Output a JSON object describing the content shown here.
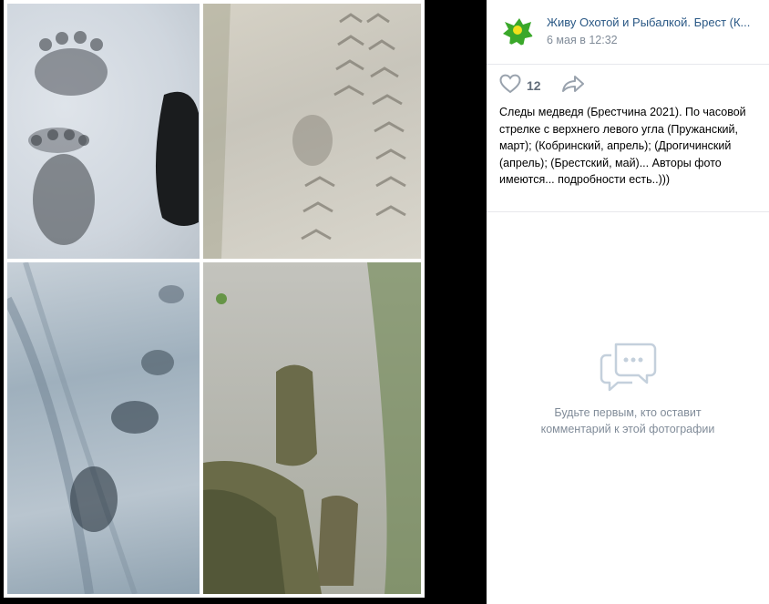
{
  "photo": {
    "alt": "",
    "tiles": [
      "track-snow",
      "track-dirt",
      "track-sand",
      "boots-on-ground"
    ]
  },
  "post": {
    "author": "Живу Охотой и Рыбалкой. Брест (К...",
    "date": "6 мая в 12:32",
    "likes": "12",
    "description": "Следы медведя (Брестчина 2021). По часовой стрелке с верхнего левого угла (Пружанский, март); (Кобринский, апрель); (Дрогичинский (апрель); (Брестский, май)... Авторы фото имеются... подробности есть..)))"
  },
  "comments": {
    "empty_text": "Будьте первым, кто оставит комментарий к этой фотографии"
  },
  "icons": {
    "like": "heart-icon",
    "share": "share-arrow-icon",
    "comments": "comments-bubble-icon"
  },
  "colors": {
    "link": "#2a5885",
    "muted": "#818c99",
    "icon": "#99a2ad",
    "avatar_green": "#3aa82a",
    "avatar_yellow": "#f0e01c"
  }
}
